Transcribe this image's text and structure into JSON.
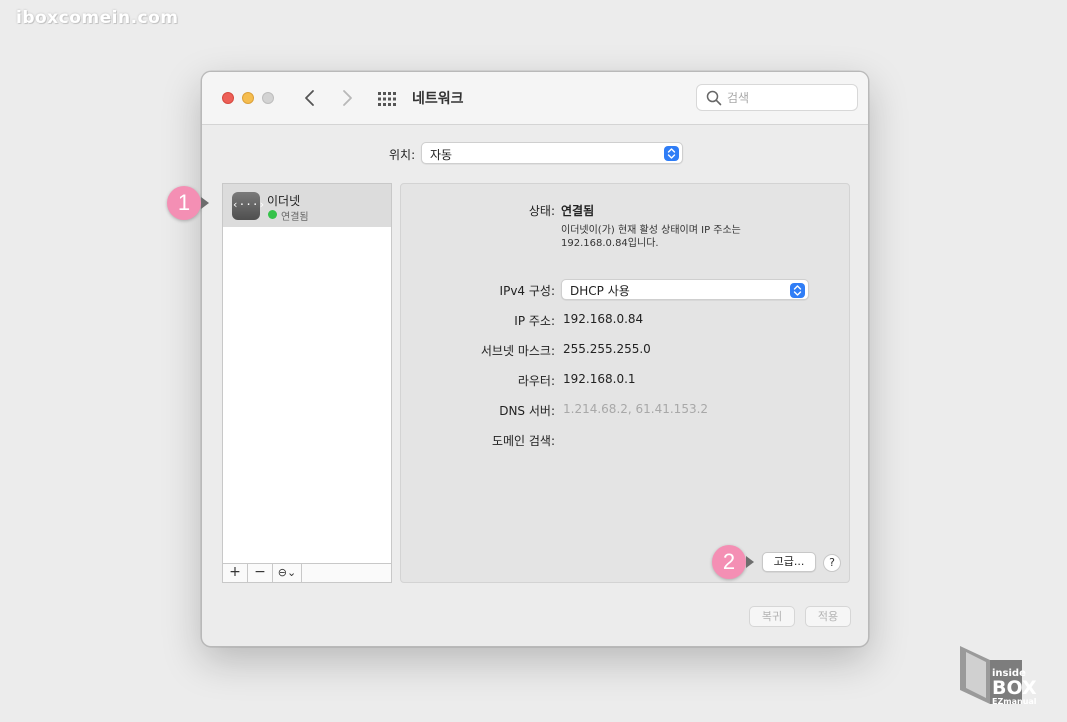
{
  "watermark": "iboxcomein.com",
  "window": {
    "title": "네트워크",
    "search_placeholder": "검색"
  },
  "location": {
    "label": "위치:",
    "value": "자동"
  },
  "sidebar": {
    "items": [
      {
        "name": "이더넷",
        "status": "연결됨",
        "status_color": "#35c24a",
        "icon": "ethernet-icon"
      }
    ],
    "toolbar": {
      "add": "+",
      "remove": "−",
      "more": "⊖⌄"
    }
  },
  "detail": {
    "status_label": "상태:",
    "status_value": "연결됨",
    "status_desc": "이더넷이(가) 현재 활성 상태이며 IP 주소는 192.168.0.84입니다.",
    "ipv4_label": "IPv4 구성:",
    "ipv4_value": "DHCP 사용",
    "ip_label": "IP 주소:",
    "ip_value": "192.168.0.84",
    "mask_label": "서브넷 마스크:",
    "mask_value": "255.255.255.0",
    "router_label": "라우터:",
    "router_value": "192.168.0.1",
    "dns_label": "DNS 서버:",
    "dns_value": "1.214.68.2, 61.41.153.2",
    "domain_label": "도메인 검색:",
    "advanced": "고급...",
    "help": "?"
  },
  "footer": {
    "revert": "복귀",
    "apply": "적용"
  },
  "annotations": {
    "badge1": "1",
    "badge2": "2"
  },
  "logo": {
    "line1": "inside",
    "line2": "BOX",
    "line3": "EZmanual"
  },
  "colors": {
    "accent": "#2f7df6",
    "badge": "#f48fb4",
    "close": "#ed5f57",
    "minimize": "#f5bd4f"
  }
}
